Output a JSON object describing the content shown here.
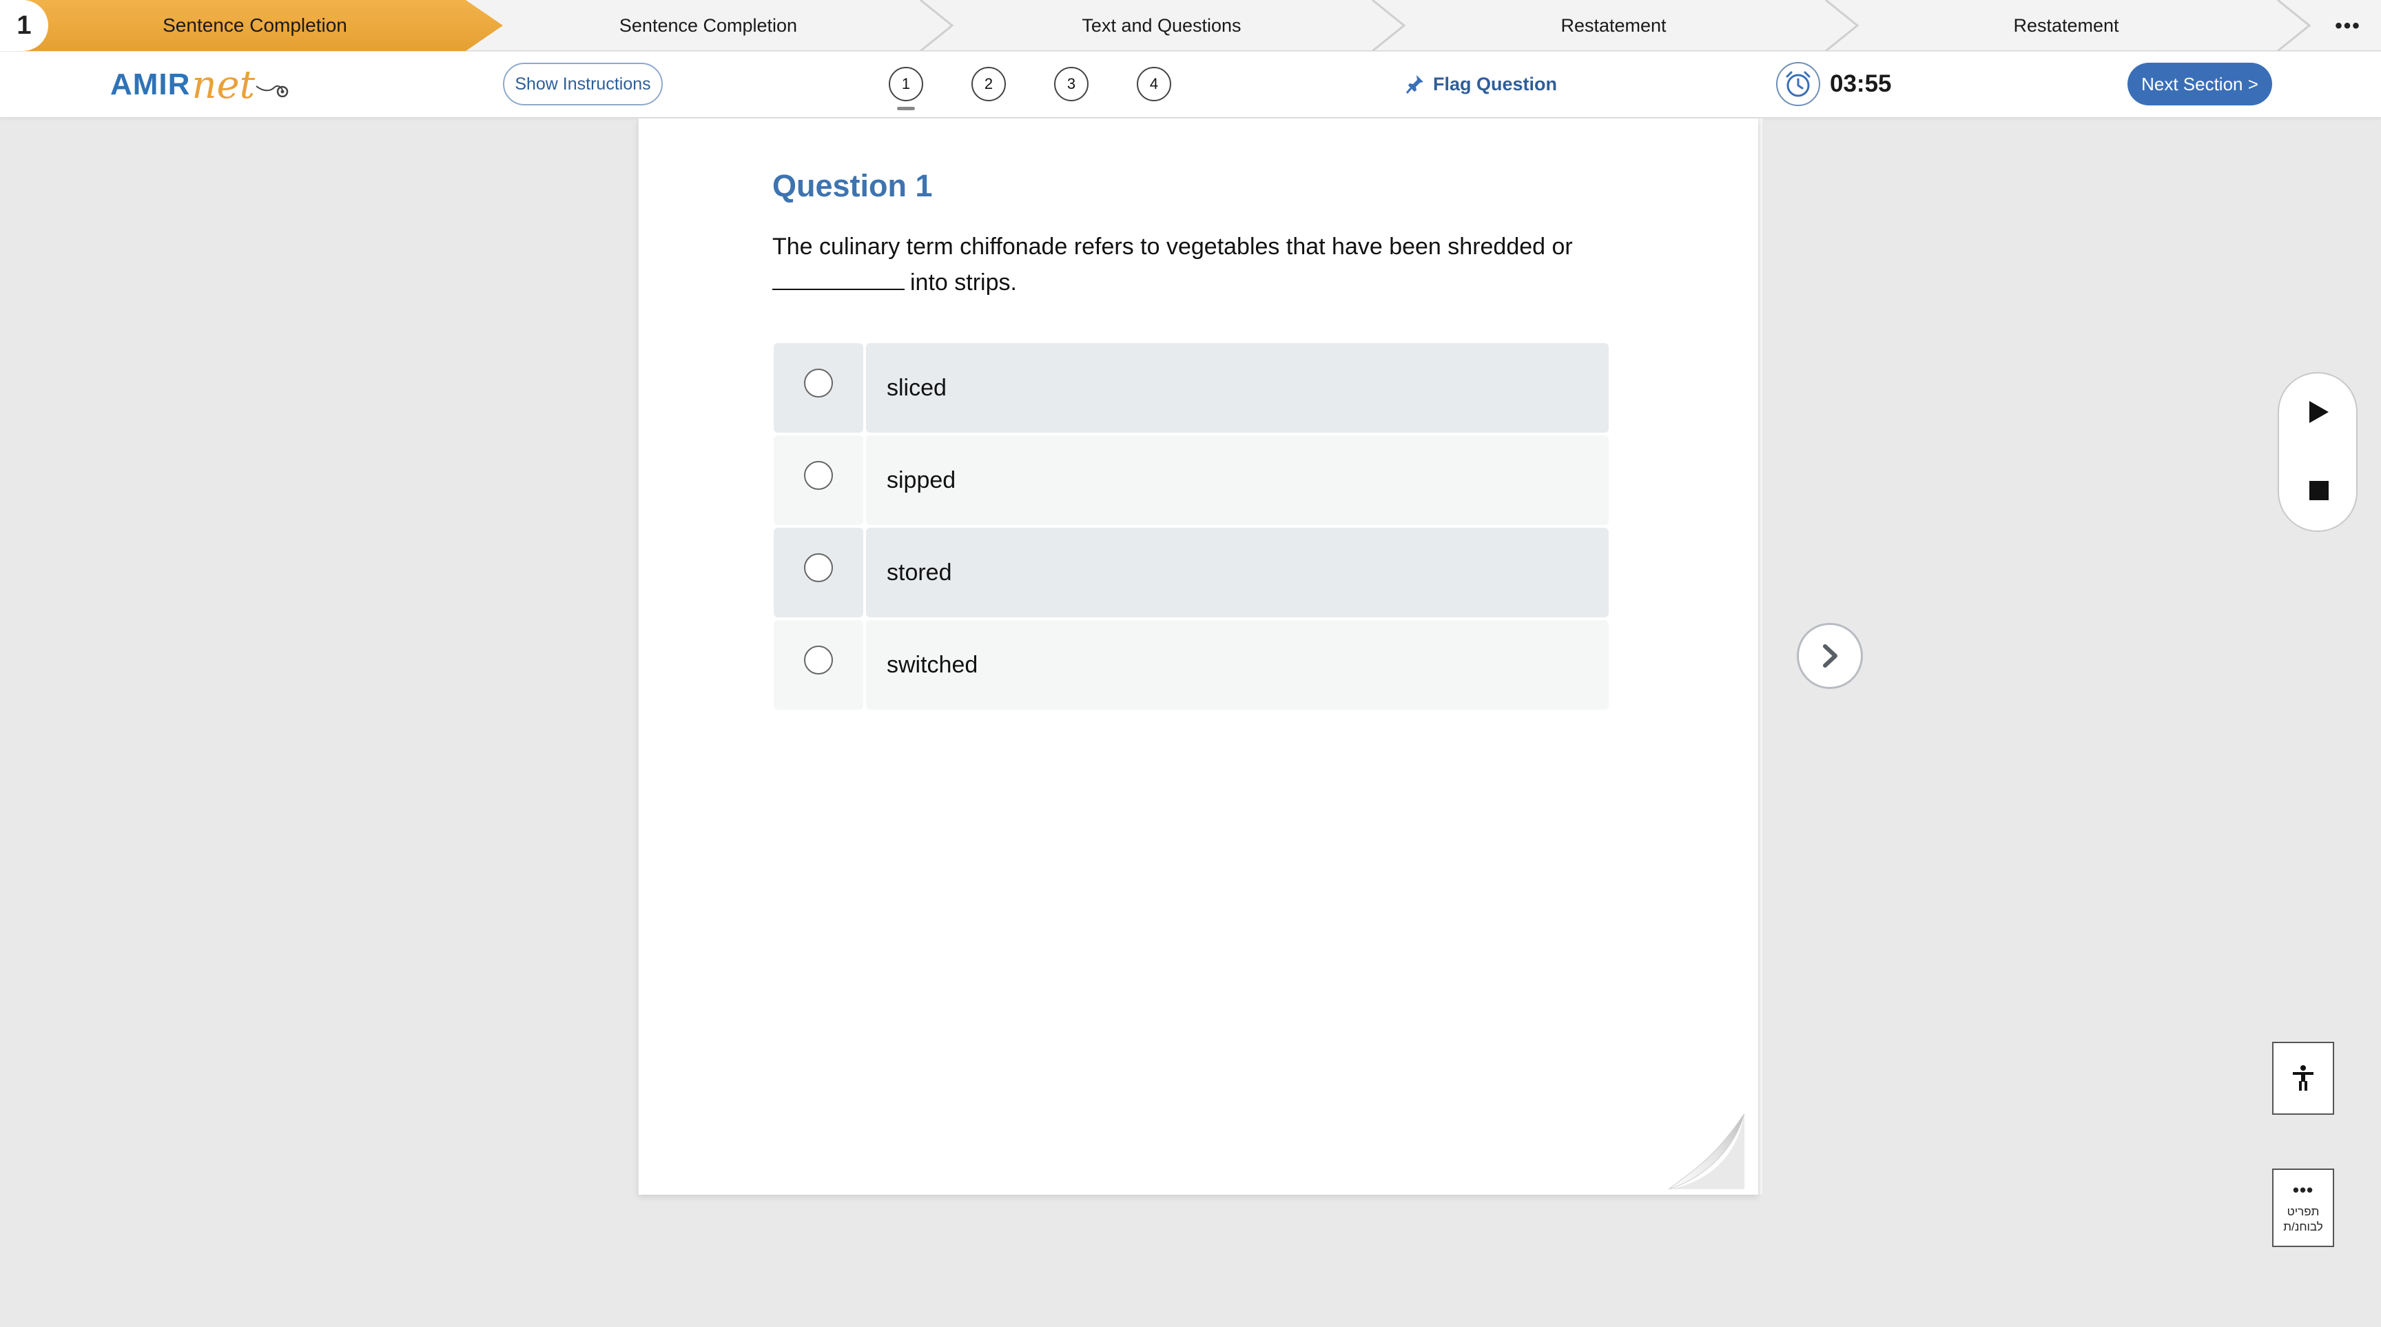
{
  "sections": {
    "current_number": "1",
    "items": [
      {
        "label": "Sentence Completion",
        "active": true
      },
      {
        "label": "Sentence Completion",
        "active": false
      },
      {
        "label": "Text and Questions",
        "active": false
      },
      {
        "label": "Restatement",
        "active": false
      },
      {
        "label": "Restatement",
        "active": false
      }
    ],
    "more_label": "•••",
    "active_color": "#e8a63b"
  },
  "toolbar": {
    "logo_part1": "AMIR",
    "logo_part2": "net",
    "show_instructions": "Show Instructions",
    "question_numbers": [
      "1",
      "2",
      "3",
      "4"
    ],
    "current_question": "1",
    "flag_label": "Flag Question",
    "timer": "03:55",
    "next_section": "Next Section >",
    "accent_color": "#3a6fb7"
  },
  "question": {
    "title": "Question 1",
    "text_before": "The culinary term chiffonade refers to vegetables that have been shredded or",
    "text_after": "into strips.",
    "answers": [
      "sliced",
      "sipped",
      "stored",
      "switched"
    ]
  },
  "side_controls": {
    "next_icon": "chevron-right-icon",
    "play_icon": "play-icon",
    "stop_icon": "stop-icon",
    "accessibility_icon": "accessibility-icon",
    "report_dots": "•••",
    "report_line1": "תפריט",
    "report_line2": "לבוחנ/ת"
  }
}
